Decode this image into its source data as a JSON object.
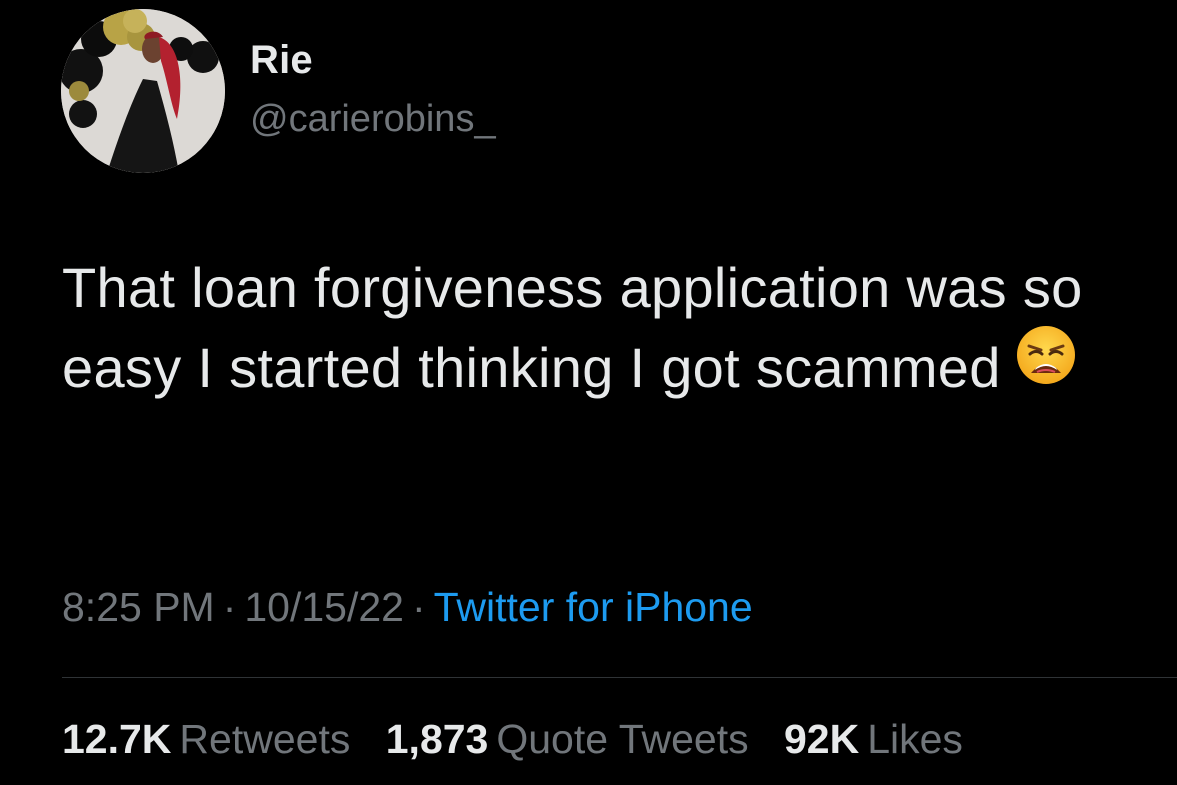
{
  "author": {
    "name": "Rie",
    "handle": "@carierobins_"
  },
  "tweet": {
    "text": "That loan forgiveness application was so easy I started thinking I got scammed",
    "emoji": "weary-face-emoji"
  },
  "meta": {
    "time": "8:25 PM",
    "separator": "·",
    "date": "10/15/22",
    "source": "Twitter for iPhone"
  },
  "stats": [
    {
      "count": "12.7K",
      "label": "Retweets"
    },
    {
      "count": "1,873",
      "label": "Quote Tweets"
    },
    {
      "count": "92K",
      "label": "Likes"
    }
  ],
  "colors": {
    "background": "#000000",
    "primary_text": "#e7e9ea",
    "secondary_text": "#71767b",
    "link": "#1d9bf0",
    "divider": "#2f3336"
  }
}
